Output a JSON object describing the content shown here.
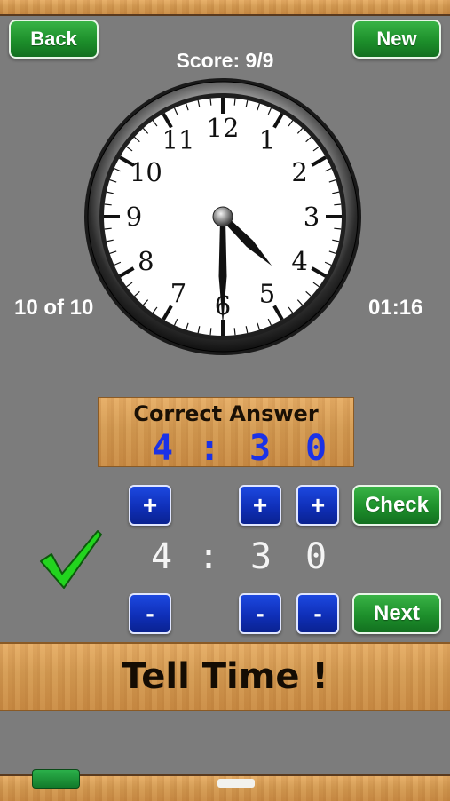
{
  "header": {
    "back_label": "Back",
    "new_label": "New",
    "score_text": "Score: 9/9"
  },
  "progress_text": "10 of 10",
  "timer_text": "01:16",
  "clock": {
    "numbers": [
      "12",
      "1",
      "2",
      "3",
      "4",
      "5",
      "6",
      "7",
      "8",
      "9",
      "10",
      "11"
    ],
    "hour": 4,
    "minute": 30
  },
  "answer_panel": {
    "title": "Correct Answer",
    "hour": "4",
    "colon": ":",
    "minute_tens": "3",
    "minute_ones": "0"
  },
  "controls": {
    "plus_label": "+",
    "minus_label": "-",
    "check_label": "Check",
    "next_label": "Next",
    "hour": "4",
    "colon": ":",
    "minute_tens": "3",
    "minute_ones": "0",
    "result_icon": "checkmark-icon"
  },
  "banner_text": "Tell Time !",
  "colors": {
    "background": "#7c7c7c",
    "button_green": "#1d8f2b",
    "button_blue": "#0f2fb8",
    "answer_digits": "#1b32e6",
    "check_mark": "#22d41e"
  }
}
